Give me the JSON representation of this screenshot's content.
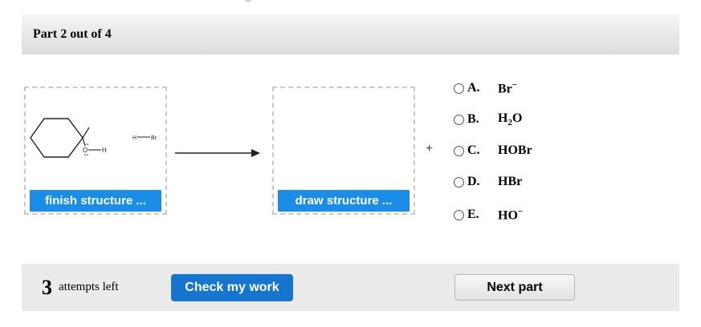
{
  "header": {
    "title": "Part 2 out of 4"
  },
  "reactant_box": {
    "button_label": "finish structure ...",
    "oh_label": "O",
    "h_label": "H",
    "reagent_h": "H",
    "reagent_br": "Br"
  },
  "product_box": {
    "button_label": "draw structure ..."
  },
  "plus_sign": "+",
  "options": [
    {
      "letter": "A.",
      "formula_base": "Br",
      "formula_sub": "",
      "formula_rest": "",
      "formula_sup": "−",
      "selected": false
    },
    {
      "letter": "B.",
      "formula_base": "H",
      "formula_sub": "2",
      "formula_rest": "O",
      "formula_sup": "",
      "selected": false
    },
    {
      "letter": "C.",
      "formula_base": "HOBr",
      "formula_sub": "",
      "formula_rest": "",
      "formula_sup": "",
      "selected": false
    },
    {
      "letter": "D.",
      "formula_base": "HBr",
      "formula_sub": "",
      "formula_rest": "",
      "formula_sup": "",
      "selected": false
    },
    {
      "letter": "E.",
      "formula_base": "HO",
      "formula_sub": "",
      "formula_rest": "",
      "formula_sup": "−",
      "selected": false
    }
  ],
  "footer": {
    "attempts_count": "3",
    "attempts_label": "attempts left",
    "check_label": "Check my work",
    "next_label": "Next part"
  },
  "colors": {
    "primary_blue": "#1a8ee6",
    "check_blue": "#1676cf"
  }
}
